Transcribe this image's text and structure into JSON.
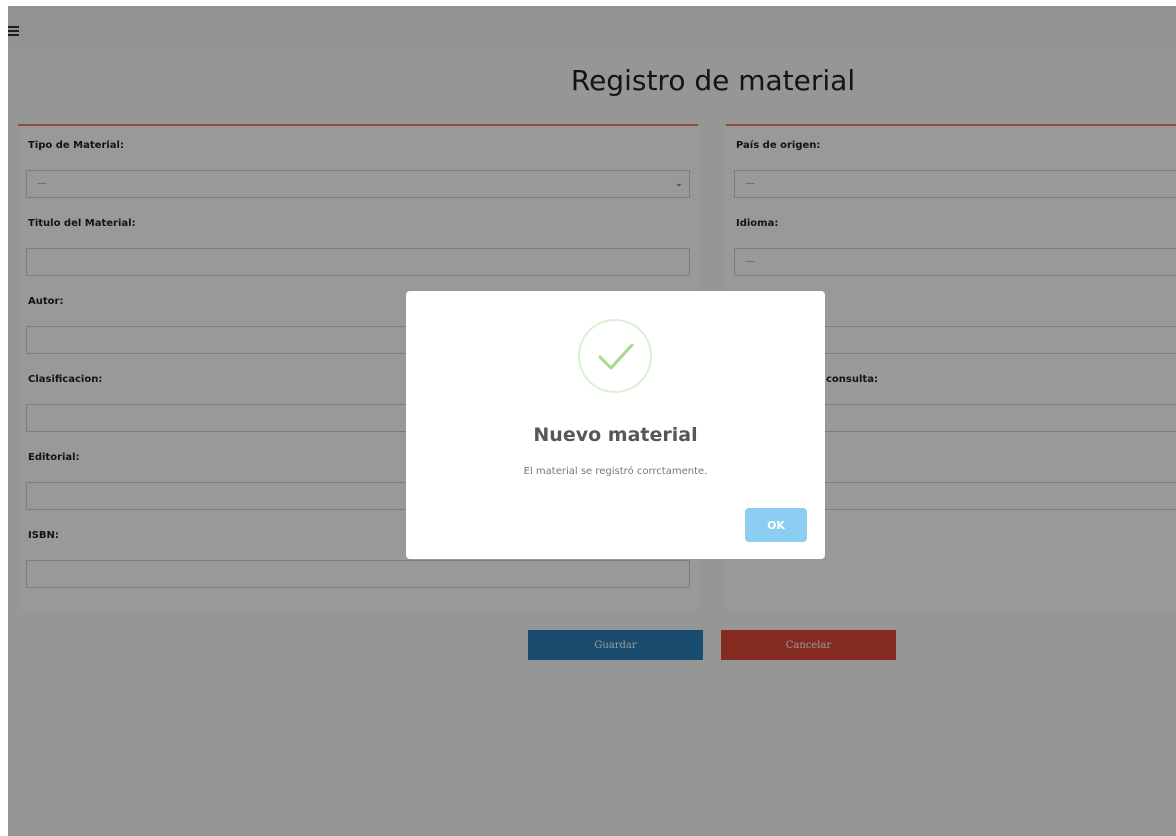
{
  "page": {
    "title": "Registro de material"
  },
  "left_form": {
    "fields": [
      {
        "label": "Tipo de Material:",
        "value": "—",
        "kind": "select"
      },
      {
        "label": "Titulo del Material:",
        "value": "",
        "kind": "text"
      },
      {
        "label": "Autor:",
        "value": "",
        "kind": "text"
      },
      {
        "label": "Clasificacion:",
        "value": "",
        "kind": "text"
      },
      {
        "label": "Editorial:",
        "value": "",
        "kind": "text"
      },
      {
        "label": "ISBN:",
        "value": "",
        "kind": "text"
      }
    ]
  },
  "right_form": {
    "fields": [
      {
        "label": "País de origen:",
        "value": "—",
        "kind": "select"
      },
      {
        "label": "Idioma:",
        "value": "—",
        "kind": "select"
      },
      {
        "label": "",
        "value": "",
        "kind": "text"
      },
      {
        "label": "consulta:",
        "value": "",
        "kind": "text"
      },
      {
        "label": "",
        "value": "",
        "kind": "text"
      },
      {
        "label": "",
        "value": "",
        "kind": "text"
      }
    ]
  },
  "actions": {
    "save_label": "Guardar",
    "cancel_label": "Cancelar"
  },
  "modal": {
    "title": "Nuevo material",
    "message": "El material se registró corrctamente.",
    "ok_label": "OK",
    "icon": "check-icon"
  },
  "colors": {
    "accent_border": "#e4826b",
    "save": "#2b7fb8",
    "cancel": "#e0493a",
    "ok": "#8ccdf2",
    "success": "#a5dc86"
  }
}
